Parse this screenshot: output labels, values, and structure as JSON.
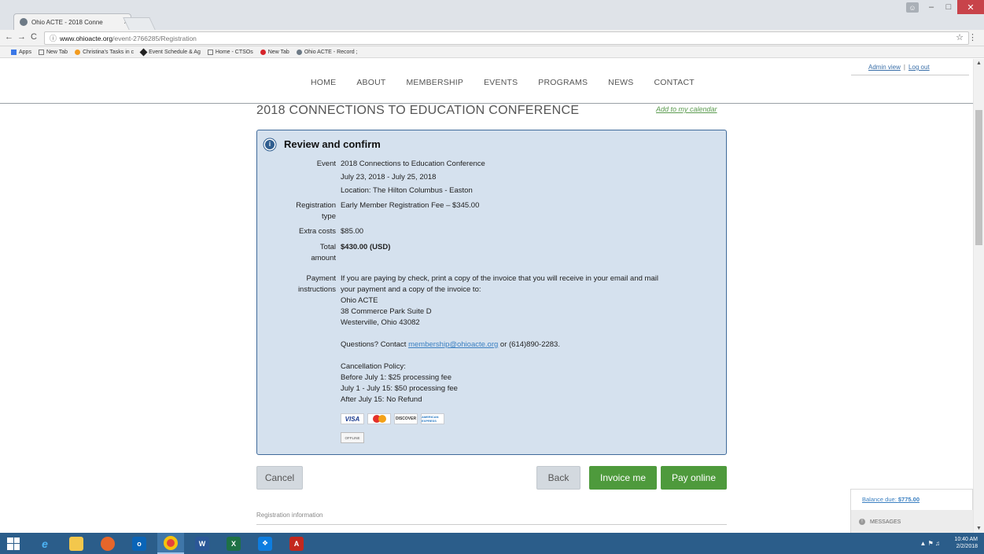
{
  "browser": {
    "tab_title": "Ohio ACTE - 2018 Conne",
    "tab_close": "×",
    "url_host": "www.ohioacte.org",
    "url_path": "/event-2766285/Registration",
    "nav_back": "←",
    "nav_forward": "→",
    "nav_reload": "C",
    "bookmarks": [
      {
        "label": "Apps"
      },
      {
        "label": "New Tab"
      },
      {
        "label": "Christina's Tasks in c"
      },
      {
        "label": "Event Schedule & Ag"
      },
      {
        "label": "Home - CTSOs"
      },
      {
        "label": "New Tab"
      },
      {
        "label": "Ohio ACTE - Record ;"
      }
    ]
  },
  "admin": {
    "admin_view": "Admin view",
    "separator": "|",
    "log_out": "Log out"
  },
  "nav": {
    "items": [
      "HOME",
      "ABOUT",
      "MEMBERSHIP",
      "EVENTS",
      "PROGRAMS",
      "NEWS",
      "CONTACT"
    ]
  },
  "event": {
    "title": "2018 CONNECTIONS TO EDUCATION CONFERENCE",
    "add_calendar": "Add to my calendar"
  },
  "confirm": {
    "heading": "Review and confirm",
    "event_label": "Event",
    "event_name": "2018 Connections to Education Conference",
    "event_dates": "July 23, 2018 - July 25, 2018",
    "event_location": "Location: The Hilton Columbus - Easton",
    "reg_type_label_1": "Registration",
    "reg_type_label_2": "type",
    "reg_type_value": "Early Member Registration Fee – $345.00",
    "extra_label": "Extra costs",
    "extra_value": "$85.00",
    "total_label_1": "Total",
    "total_label_2": "amount",
    "total_value": "$430.00 (USD)",
    "pay_label_1": "Payment",
    "pay_label_2": "instructions",
    "pay_line_1": "If you are paying by check, print a copy of the invoice that you will receive in your email and mail",
    "pay_line_2": "your payment and a copy of the invoice to:",
    "addr_1": "Ohio ACTE",
    "addr_2": "38 Commerce Park Suite D",
    "addr_3": "Westerville, Ohio 43082",
    "questions_pre": "Questions? Contact ",
    "questions_email": "membership@ohioacte.org",
    "questions_post": " or (614)890-2283.",
    "cancel_title": "Cancellation Policy:",
    "cancel_1": "Before July 1: $25 processing fee",
    "cancel_2": "July 1 - July 15: $50 processing fee",
    "cancel_3": "After July 15: No Refund",
    "cards": {
      "visa": "VISA",
      "discover": "DISCOVER",
      "amex": "AMERICAN EXPRESS",
      "offline": "OFFLINE"
    }
  },
  "buttons": {
    "cancel": "Cancel",
    "back": "Back",
    "invoice": "Invoice me",
    "pay": "Pay online"
  },
  "reg_info": "Registration information",
  "balance": {
    "label": "Balance due: ",
    "amount": "$775.00",
    "messages": "MESSAGES"
  },
  "taskbar": {
    "time": "10:40 AM",
    "date": "2/2/2018"
  }
}
